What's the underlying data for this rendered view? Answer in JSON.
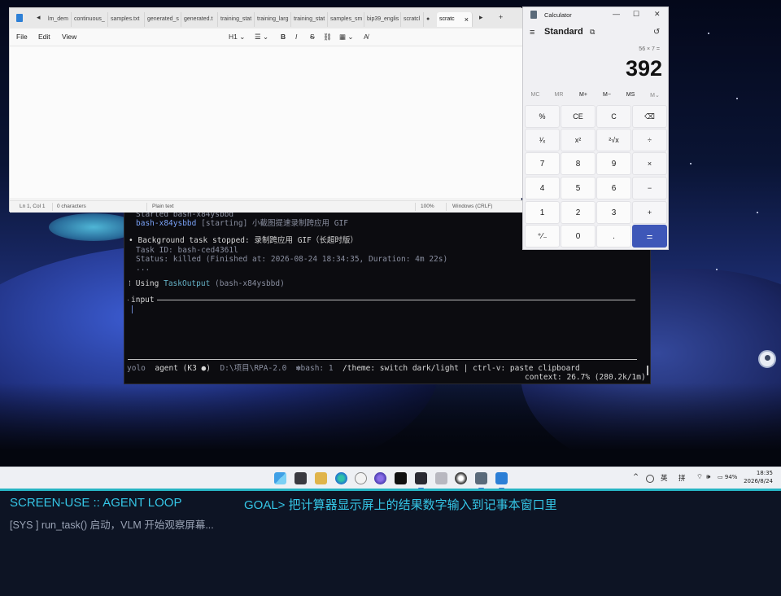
{
  "terminal": {
    "line_started": "Started bash-x84ysbbd",
    "line_starting_id": "bash-x84ysbbd",
    "line_starting_state": "[starting]",
    "line_starting_desc": "小截图提速录制跨应用 GIF",
    "bullet1": "•",
    "stopped_label": "Background task stopped:",
    "stopped_desc": "录制跨应用 GIF（长超时版）",
    "task_id": "Task ID: bash-ced4361l",
    "status": "Status: killed (Finished at: 2026-08-24 18:34:35, Duration: 4m 22s)",
    "ellipsis": "...",
    "bullet2": "⁝",
    "using_label": "Using",
    "using_tool": "TaskOutput",
    "using_arg": "(bash-x84ysbbd)",
    "input_label": "input",
    "footer_mode": "yolo",
    "footer_agent": "agent (K3 ●)",
    "footer_path": "D:\\项目\\RPA-2.0",
    "footer_bash": "✽bash: 1",
    "footer_hint": "/theme: switch dark/light | ctrl-v: paste clipboard",
    "footer_context": "context: 26.7% (280.2k/1m)"
  },
  "notepad": {
    "tab_nav_left": "◂",
    "tabs": [
      "lm_dem",
      "continuous_",
      "samples.txt",
      "generated_s",
      "generated.t",
      "training_stat",
      "training_larg",
      "training_stat",
      "samples_sm",
      "bip39_englis",
      "scratcl",
      "●",
      "scratc"
    ],
    "tab_close": "×",
    "tab_nav_right": "▸",
    "tab_add": "+",
    "menu": {
      "file": "File",
      "edit": "Edit",
      "view": "View"
    },
    "format": {
      "heading": "H1 ⌄",
      "list": "☰ ⌄",
      "bold": "B",
      "italic": "I",
      "strike": "S",
      "link": "⛓",
      "table": "▦ ⌄",
      "clear": "A̸"
    },
    "status": {
      "position": "Ln 1, Col 1",
      "chars": "0 characters",
      "format": "Plain text",
      "zoom": "100%",
      "encoding": "Windows (CRLF)"
    }
  },
  "calculator": {
    "title": "Calculator",
    "minimize": "—",
    "maximize": "☐",
    "close": "✕",
    "menu_icon": "≡",
    "mode": "Standard",
    "keep_on_top_icon": "⧉",
    "history_icon": "↺",
    "expression": "56 × 7 =",
    "result": "392",
    "memory": [
      "MC",
      "MR",
      "M+",
      "M−",
      "MS",
      "M⌄"
    ],
    "keys": [
      [
        "%",
        "CE",
        "C",
        "⌫"
      ],
      [
        "¹⁄ₓ",
        "x²",
        "²√x",
        "÷"
      ],
      [
        "7",
        "8",
        "9",
        "×"
      ],
      [
        "4",
        "5",
        "6",
        "−"
      ],
      [
        "1",
        "2",
        "3",
        "+"
      ],
      [
        "⁺⁄₋",
        "0",
        ".",
        "="
      ]
    ]
  },
  "taskbar": {
    "tray_chevron": "^",
    "tray_lang1": "英",
    "tray_lang2": "拼",
    "tray_battery": "94%",
    "time": "18:35",
    "date": "2026/8/24"
  },
  "agent": {
    "title": "SCREEN-USE :: AGENT LOOP",
    "goal": "GOAL> 把计算器显示屏上的结果数字输入到记事本窗口里",
    "log": "[SYS ] run_task() 启动，VLM 开始观察屏幕..."
  },
  "colors": {
    "accent": "#3e57b8",
    "agent_text": "#35c6e6",
    "terminal_bg": "#0c0c10"
  }
}
